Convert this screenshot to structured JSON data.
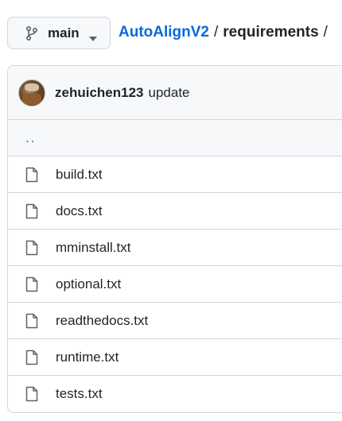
{
  "branch": {
    "label": "main",
    "icon": "git-branch-icon",
    "caret_icon": "caret-down-icon"
  },
  "breadcrumb": {
    "repo": "AutoAlignV2",
    "separator": "/",
    "current": "requirements",
    "trailing": "/"
  },
  "commit": {
    "author": "zehuichen123",
    "message": "update"
  },
  "parent_link": "..",
  "files": [
    {
      "name": "build.txt",
      "icon": "file-icon"
    },
    {
      "name": "docs.txt",
      "icon": "file-icon"
    },
    {
      "name": "mminstall.txt",
      "icon": "file-icon"
    },
    {
      "name": "optional.txt",
      "icon": "file-icon"
    },
    {
      "name": "readthedocs.txt",
      "icon": "file-icon"
    },
    {
      "name": "runtime.txt",
      "icon": "file-icon"
    },
    {
      "name": "tests.txt",
      "icon": "file-icon"
    }
  ],
  "colors": {
    "link": "#0969da",
    "text": "#1f2328",
    "border": "#d0d7de",
    "muted_bg": "#f6f8fa"
  }
}
